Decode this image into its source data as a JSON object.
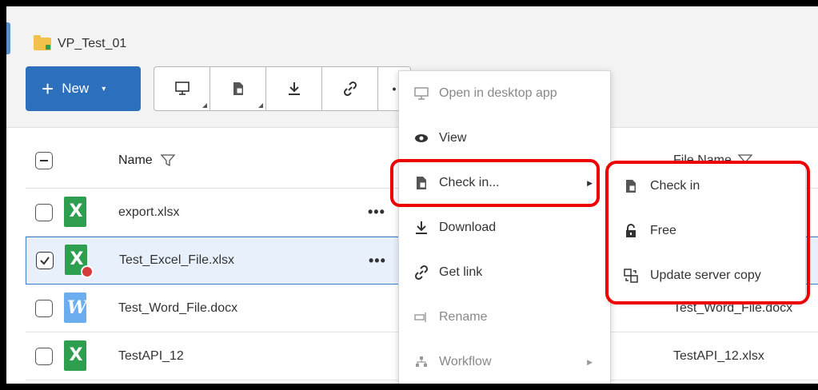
{
  "folder": {
    "name": "VP_Test_01"
  },
  "new_button": {
    "label": "New",
    "plus": "+",
    "caret": "▾"
  },
  "toolbar": {
    "icons": [
      "monitor-icon",
      "checkin-icon",
      "download-icon",
      "link-icon",
      "more-icon"
    ]
  },
  "table": {
    "header_name": "Name",
    "header_file_name": "File Name",
    "rows": [
      {
        "name": "export.xlsx",
        "type": "excel",
        "checked": false,
        "file_name": "",
        "actions": "•••"
      },
      {
        "name": "Test_Excel_File.xlsx",
        "type": "excel-locked",
        "checked": true,
        "file_name": "",
        "actions": "•••"
      },
      {
        "name": "Test_Word_File.docx",
        "type": "word",
        "checked": false,
        "file_name": "Test_Word_File.docx",
        "actions": ""
      },
      {
        "name": "TestAPI_12",
        "type": "excel",
        "checked": false,
        "file_name": "TestAPI_12.xlsx",
        "actions": ""
      }
    ]
  },
  "context_menu": {
    "items": [
      {
        "label": "Open in desktop app",
        "icon": "monitor-icon",
        "disabled": true
      },
      {
        "label": "View",
        "icon": "eye-icon",
        "disabled": false
      },
      {
        "label": "Check in...",
        "icon": "checkin-icon",
        "disabled": false,
        "submenu": true
      },
      {
        "label": "Download",
        "icon": "download-icon",
        "disabled": false
      },
      {
        "label": "Get link",
        "icon": "link-icon",
        "disabled": false
      },
      {
        "label": "Rename",
        "icon": "rename-icon",
        "disabled": true
      },
      {
        "label": "Workflow",
        "icon": "workflow-icon",
        "disabled": true,
        "submenu": true
      }
    ]
  },
  "submenu": {
    "items": [
      {
        "label": "Check in",
        "icon": "checkin-icon"
      },
      {
        "label": "Free",
        "icon": "unlock-icon"
      },
      {
        "label": "Update server copy",
        "icon": "update-icon"
      }
    ]
  },
  "colors": {
    "accent": "#2b6fbd",
    "highlight": "#e00000",
    "excel": "#2d9f4f",
    "word": "#6aaef0"
  }
}
